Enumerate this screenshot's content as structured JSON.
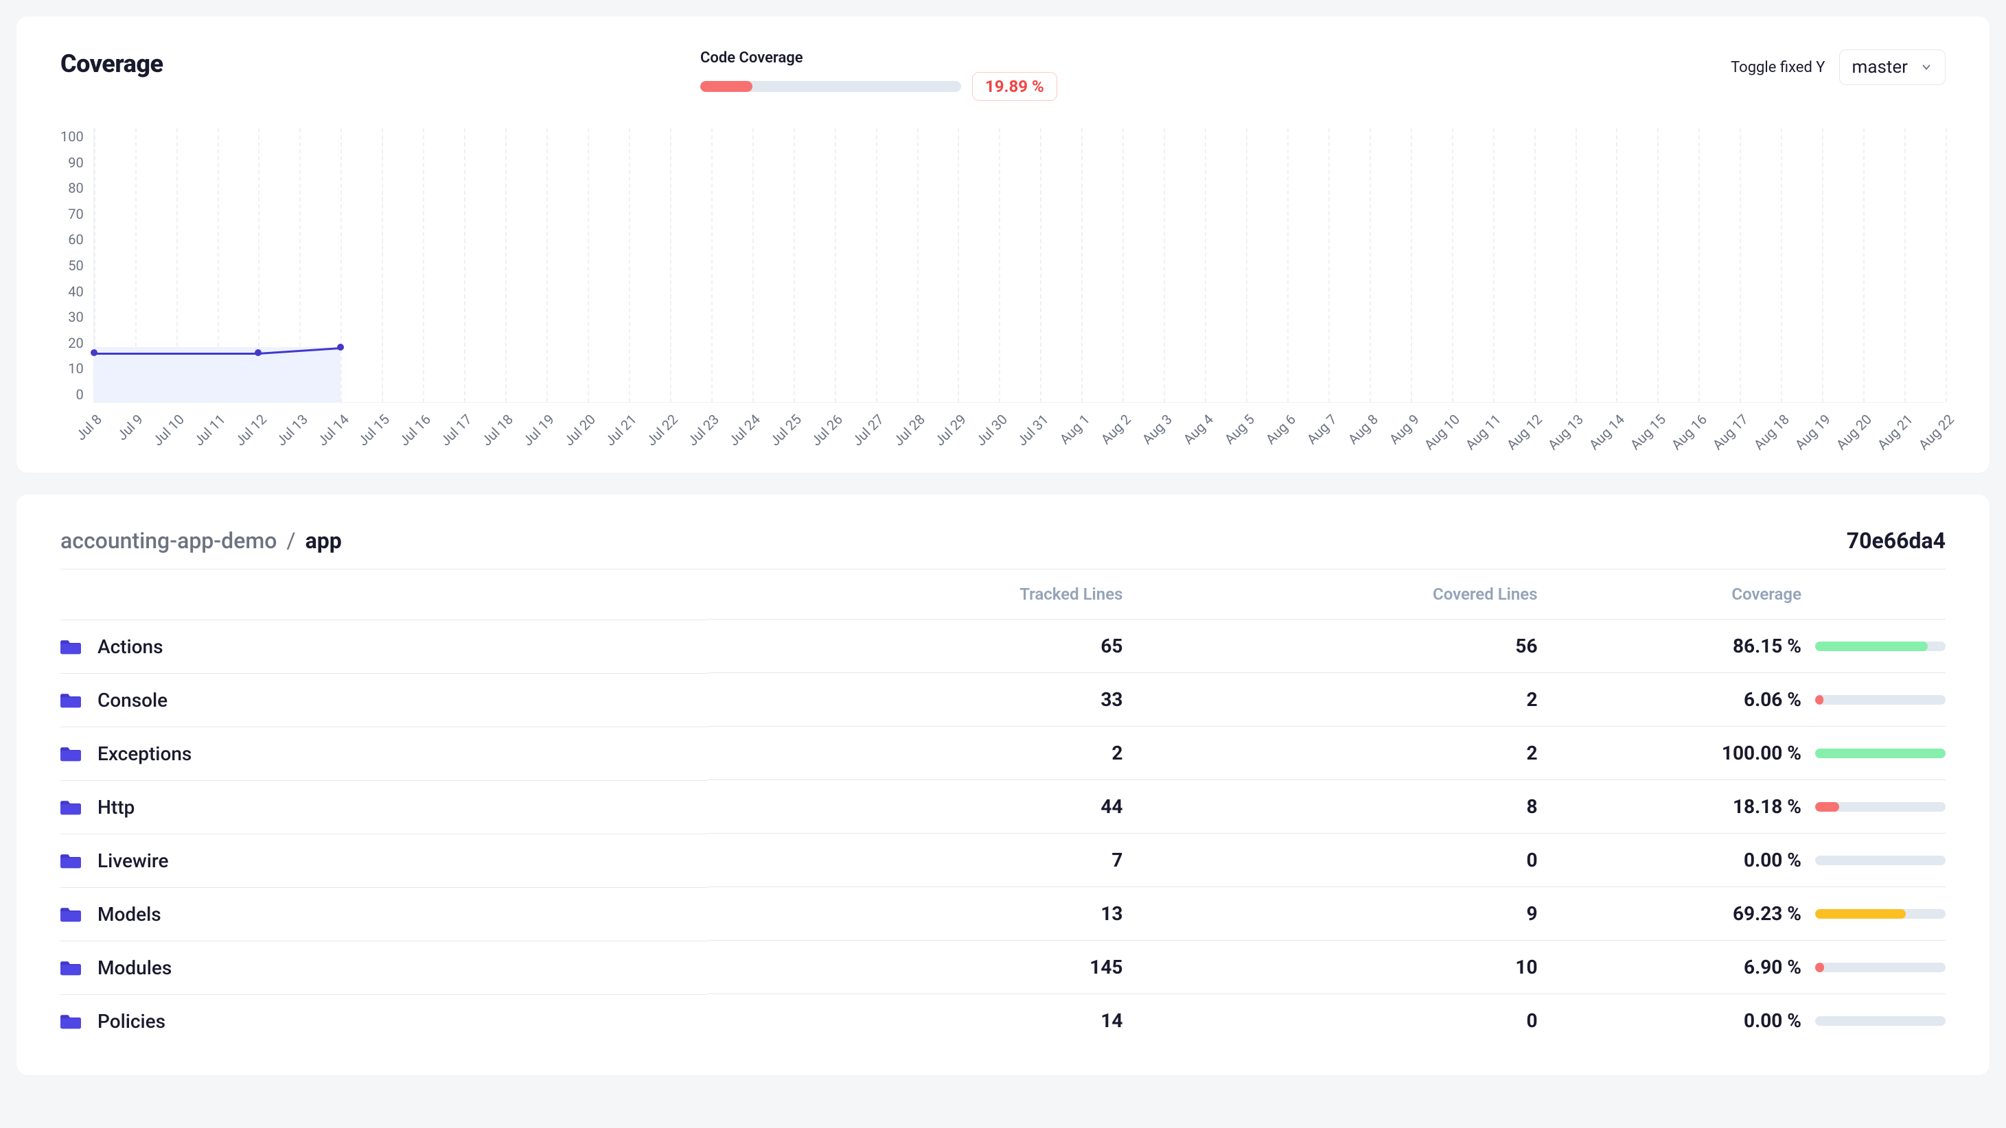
{
  "header": {
    "title": "Coverage",
    "code_coverage_label": "Code Coverage",
    "overall_pct_text": "19.89 %",
    "overall_pct": 19.89,
    "toggle_label": "Toggle fixed Y",
    "branch": "master"
  },
  "chart_data": {
    "type": "line",
    "ylabel": "",
    "xlabel": "",
    "ylim": [
      0,
      100
    ],
    "y_ticks": [
      100,
      90,
      80,
      70,
      60,
      50,
      40,
      30,
      20,
      10,
      0
    ],
    "categories": [
      "Jul 8",
      "Jul 9",
      "Jul 10",
      "Jul 11",
      "Jul 12",
      "Jul 13",
      "Jul 14",
      "Jul 15",
      "Jul 16",
      "Jul 17",
      "Jul 18",
      "Jul 19",
      "Jul 20",
      "Jul 21",
      "Jul 22",
      "Jul 23",
      "Jul 24",
      "Jul 25",
      "Jul 26",
      "Jul 27",
      "Jul 28",
      "Jul 29",
      "Jul 30",
      "Jul 31",
      "Aug 1",
      "Aug 2",
      "Aug 3",
      "Aug 4",
      "Aug 5",
      "Aug 6",
      "Aug 7",
      "Aug 8",
      "Aug 9",
      "Aug 10",
      "Aug 11",
      "Aug 12",
      "Aug 13",
      "Aug 14",
      "Aug 15",
      "Aug 16",
      "Aug 17",
      "Aug 18",
      "Aug 19",
      "Aug 20",
      "Aug 21",
      "Aug 22"
    ],
    "series": [
      {
        "name": "coverage",
        "points": [
          {
            "x": "Jul 8",
            "y": 18
          },
          {
            "x": "Jul 12",
            "y": 18
          },
          {
            "x": "Jul 14",
            "y": 20
          }
        ]
      }
    ]
  },
  "files": {
    "breadcrumb_root": "accounting-app-demo",
    "breadcrumb_leaf": "app",
    "commit": "70e66da4",
    "columns": {
      "name": "",
      "tracked": "Tracked Lines",
      "covered": "Covered Lines",
      "coverage": "Coverage"
    },
    "rows": [
      {
        "name": "Actions",
        "tracked": 65,
        "covered": 56,
        "coverage_text": "86.15 %",
        "coverage": 86.15,
        "color": "#86efac"
      },
      {
        "name": "Console",
        "tracked": 33,
        "covered": 2,
        "coverage_text": "6.06 %",
        "coverage": 6.06,
        "color": "#f87171"
      },
      {
        "name": "Exceptions",
        "tracked": 2,
        "covered": 2,
        "coverage_text": "100.00 %",
        "coverage": 100.0,
        "color": "#86efac"
      },
      {
        "name": "Http",
        "tracked": 44,
        "covered": 8,
        "coverage_text": "18.18 %",
        "coverage": 18.18,
        "color": "#f87171"
      },
      {
        "name": "Livewire",
        "tracked": 7,
        "covered": 0,
        "coverage_text": "0.00 %",
        "coverage": 0.0,
        "color": "#e2e8f0"
      },
      {
        "name": "Models",
        "tracked": 13,
        "covered": 9,
        "coverage_text": "69.23 %",
        "coverage": 69.23,
        "color": "#fbbf24"
      },
      {
        "name": "Modules",
        "tracked": 145,
        "covered": 10,
        "coverage_text": "6.90 %",
        "coverage": 6.9,
        "color": "#f87171"
      },
      {
        "name": "Policies",
        "tracked": 14,
        "covered": 0,
        "coverage_text": "0.00 %",
        "coverage": 0.0,
        "color": "#e2e8f0"
      }
    ]
  }
}
